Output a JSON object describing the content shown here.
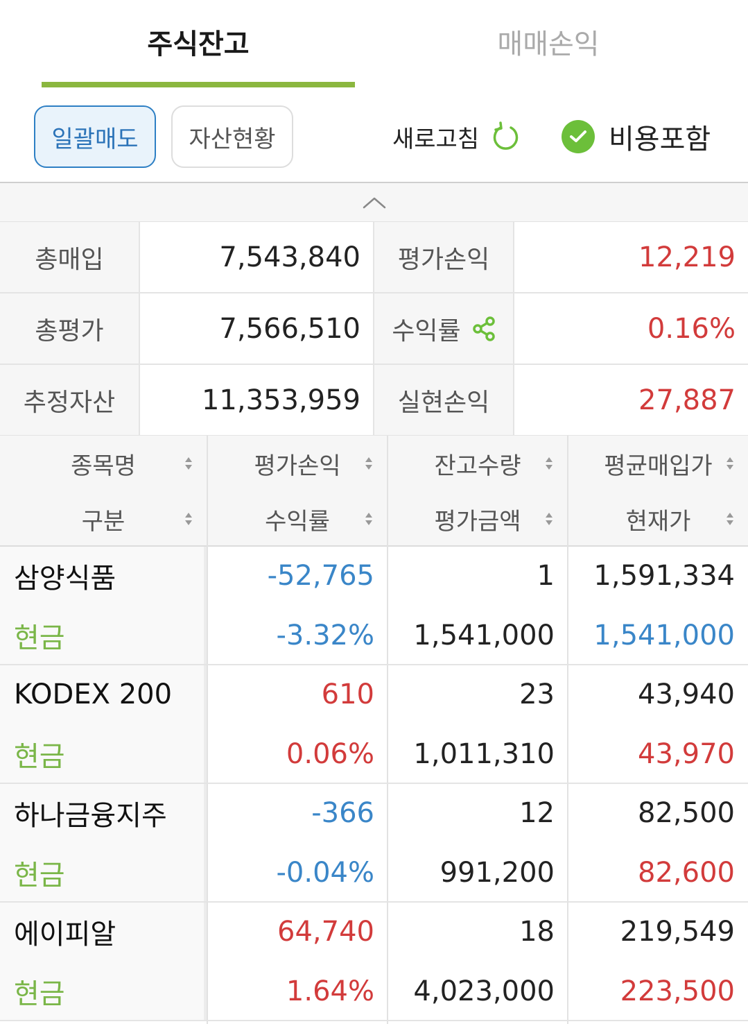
{
  "tabs": [
    {
      "label": "주식잔고",
      "active": true
    },
    {
      "label": "매매손익",
      "active": false
    }
  ],
  "toolbar": {
    "bulk_sell": "일괄매도",
    "asset_status": "자산현황",
    "refresh": "새로고침",
    "include_cost": "비용포함",
    "include_cost_checked": true
  },
  "colors": {
    "accent_green": "#8bb73f",
    "profit_red": "#d23b3b",
    "loss_blue": "#3a86c8",
    "button_blue": "#2d7fc4"
  },
  "summary": {
    "rows": [
      {
        "label1": "총매입",
        "value1": "7,543,840",
        "label2": "평가손익",
        "value2": "12,219"
      },
      {
        "label1": "총평가",
        "value1": "7,566,510",
        "label2": "수익률",
        "value2": "0.16%"
      },
      {
        "label1": "추정자산",
        "value1": "11,353,959",
        "label2": "실현손익",
        "value2": "27,887"
      }
    ]
  },
  "table": {
    "headers_top": [
      "종목명",
      "평가손익",
      "잔고수량",
      "평균매입가"
    ],
    "headers_bottom": [
      "구분",
      "수익률",
      "평가금액",
      "현재가"
    ],
    "rows": [
      {
        "name": "삼양식품",
        "type": "현금",
        "pnl": "-52,765",
        "rate": "-3.32%",
        "qty": "1",
        "eval": "1,541,000",
        "avg": "1,591,334",
        "price": "1,541,000"
      },
      {
        "name": "KODEX 200",
        "type": "현금",
        "pnl": "610",
        "rate": "0.06%",
        "qty": "23",
        "eval": "1,011,310",
        "avg": "43,940",
        "price": "43,970"
      },
      {
        "name": "하나금융지주",
        "type": "현금",
        "pnl": "-366",
        "rate": "-0.04%",
        "qty": "12",
        "eval": "991,200",
        "avg": "82,500",
        "price": "82,600"
      },
      {
        "name": "에이피알",
        "type": "현금",
        "pnl": "64,740",
        "rate": "1.64%",
        "qty": "18",
        "eval": "4,023,000",
        "avg": "219,549",
        "price": "223,500"
      }
    ]
  }
}
